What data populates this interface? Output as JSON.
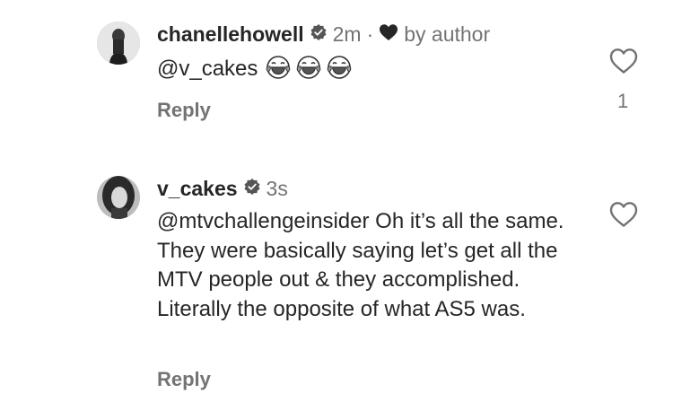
{
  "comments": [
    {
      "username": "chanellehowell",
      "time": "2m",
      "liked_by_author": "by author",
      "mention": "@v_cakes",
      "text": "",
      "emoji_names": [
        "laughing-crying-emoji",
        "laughing-crying-emoji",
        "laughing-crying-emoji"
      ],
      "reply_label": "Reply",
      "like_count": "1"
    },
    {
      "username": "v_cakes",
      "time": "3s",
      "mention": "@mtvchallengeinsider",
      "text": " Oh it’s all the same.  They were basically saying let’s get all the MTV people out & they accomplished.  Literally the opposite of what AS5 was.",
      "reply_label": "Reply"
    }
  ]
}
